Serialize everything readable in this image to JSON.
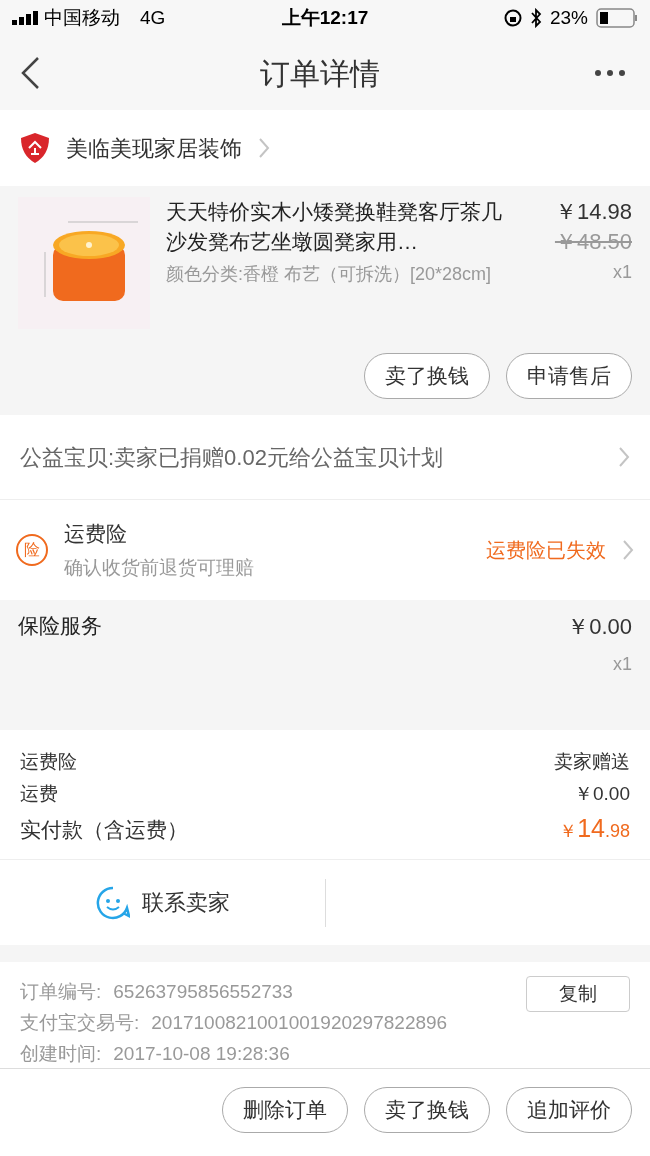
{
  "status_bar": {
    "carrier": "中国移动",
    "network": "4G",
    "time": "上午12:17",
    "battery": "23%"
  },
  "nav": {
    "title": "订单详情"
  },
  "shop": {
    "name": "美临美现家居装饰"
  },
  "product": {
    "title": "天天特价实木小矮凳换鞋凳客厅茶几沙发凳布艺坐墩圆凳家用…",
    "price": "￥14.98",
    "original_price": "￥48.50",
    "quantity": "x1",
    "option": "颜色分类:香橙 布艺（可拆洗）[20*28cm]",
    "buttons": [
      "卖了换钱",
      "申请售后"
    ]
  },
  "charity": {
    "text": "公益宝贝:卖家已捐赠0.02元给公益宝贝计划"
  },
  "freight_insurance": {
    "badge": "险",
    "title": "运费险",
    "subtitle": "确认收货前退货可理赔",
    "status": "运费险已失效"
  },
  "insurance_service": {
    "name": "保险服务",
    "price": "￥0.00",
    "quantity": "x1"
  },
  "summary": {
    "rows": [
      {
        "label": "运费险",
        "value": "卖家赠送"
      },
      {
        "label": "运费",
        "value": "￥0.00"
      }
    ],
    "total": {
      "label": "实付款（含运费）",
      "currency": "￥",
      "integer": "14",
      "decimal": ".98"
    }
  },
  "contact": {
    "label": "联系卖家"
  },
  "order_info": {
    "rows": [
      {
        "label": "订单编号:",
        "value": "65263795856552733"
      },
      {
        "label": "支付宝交易号:",
        "value": "2017100821001001920297822896"
      },
      {
        "label": "创建时间:",
        "value": "2017-10-08 19:28:36"
      }
    ],
    "copy_button": "复制"
  },
  "actions": [
    "删除订单",
    "卖了换钱",
    "追加评价"
  ]
}
